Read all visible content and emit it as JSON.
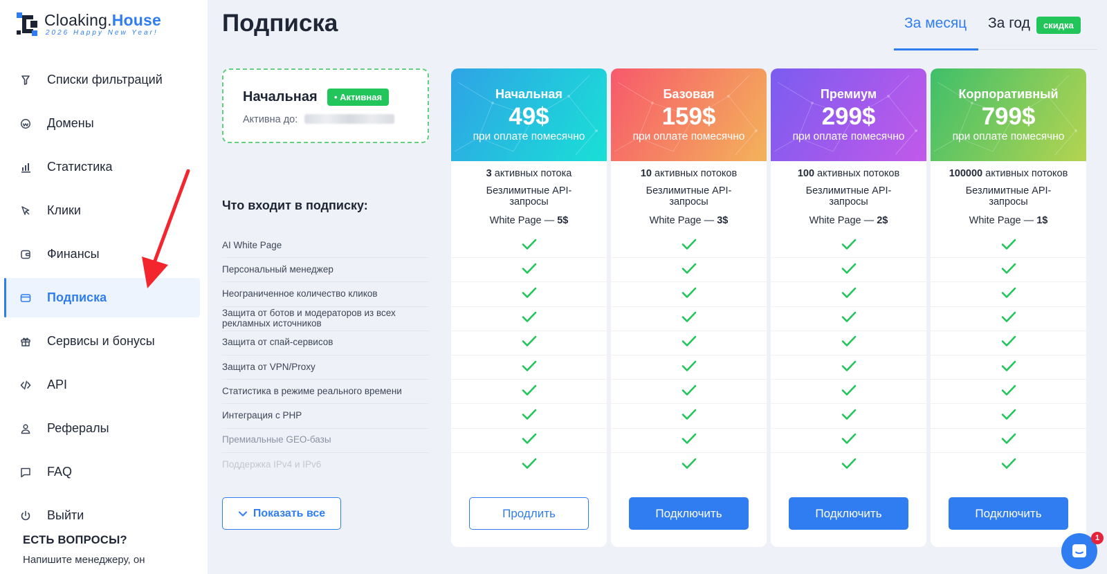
{
  "logo": {
    "title_part1": "Cloaking.",
    "title_part2": "House",
    "subtitle": "2026 Happy New Year!"
  },
  "sidebar": {
    "items": [
      {
        "label": "Списки фильтраций",
        "icon": "funnel-icon"
      },
      {
        "label": "Домены",
        "icon": "globe-icon"
      },
      {
        "label": "Статистика",
        "icon": "bar-chart-icon"
      },
      {
        "label": "Клики",
        "icon": "cursor-icon"
      },
      {
        "label": "Финансы",
        "icon": "wallet-icon"
      },
      {
        "label": "Подписка",
        "icon": "card-icon",
        "active": true
      },
      {
        "label": "Сервисы и бонусы",
        "icon": "gift-icon"
      },
      {
        "label": "API",
        "icon": "code-icon"
      },
      {
        "label": "Рефералы",
        "icon": "user-icon"
      },
      {
        "label": "FAQ",
        "icon": "chat-icon"
      },
      {
        "label": "Выйти",
        "icon": "power-icon"
      }
    ],
    "questions_title": "ЕСТЬ ВОПРОСЫ?",
    "questions_text": "Напишите менеджеру, он"
  },
  "page": {
    "title": "Подписка",
    "tabs": {
      "month": "За месяц",
      "year": "За год",
      "discount": "скидка",
      "selected": "month"
    }
  },
  "current_plan": {
    "name": "Начальная",
    "badge": "Активная",
    "active_until_label": "Активна до:"
  },
  "features": {
    "heading": "Что входит в подписку:",
    "items": [
      "AI White Page",
      "Персональный менеджер",
      "Неограниченное количество кликов",
      "Защита от ботов и модераторов из всех рекламных источников",
      "Защита от спай-сервисов",
      "Защита от VPN/Proxy",
      "Статистика в режиме реального времени",
      "Интеграция с PHP",
      "Премиальные GEO-базы",
      "Поддержка IPv4 и IPv6"
    ],
    "show_all": "Показать все"
  },
  "plans": [
    {
      "name": "Начальная",
      "price": "49$",
      "period": "при оплате помесячно",
      "streams_count": "3",
      "streams_text": "активных потока",
      "api": "Безлимитные API-запросы",
      "wp_label": "White Page —",
      "wp_price": "5$",
      "button": "Продлить",
      "button_style": "outline",
      "gradient_from": "#2fa3e6",
      "gradient_to": "#19e0d6"
    },
    {
      "name": "Базовая",
      "price": "159$",
      "period": "при оплате помесячно",
      "streams_count": "10",
      "streams_text": "активных потоков",
      "api": "Безлимитные API-запросы",
      "wp_label": "White Page —",
      "wp_price": "3$",
      "button": "Подключить",
      "button_style": "solid",
      "gradient_from": "#f7596b",
      "gradient_to": "#f3b35a"
    },
    {
      "name": "Премиум",
      "price": "299$",
      "period": "при оплате помесячно",
      "streams_count": "100",
      "streams_text": "активных потоков",
      "api": "Безлимитные API-запросы",
      "wp_label": "White Page —",
      "wp_price": "2$",
      "button": "Подключить",
      "button_style": "solid",
      "gradient_from": "#7b5cf0",
      "gradient_to": "#c259e9"
    },
    {
      "name": "Корпоративный",
      "price": "799$",
      "period": "при оплате помесячно",
      "streams_count": "100000",
      "streams_text": "активных потоков",
      "api": "Безлимитные API-запросы",
      "wp_label": "White Page —",
      "wp_price": "1$",
      "button": "Подключить",
      "button_style": "solid",
      "gradient_from": "#3fbf6a",
      "gradient_to": "#b5d450"
    }
  ],
  "chat": {
    "badge_count": "1"
  },
  "colors": {
    "accent": "#2f7df0",
    "success": "#21c55a",
    "check": "#21c55a",
    "annotation_arrow": "#f2262c"
  }
}
